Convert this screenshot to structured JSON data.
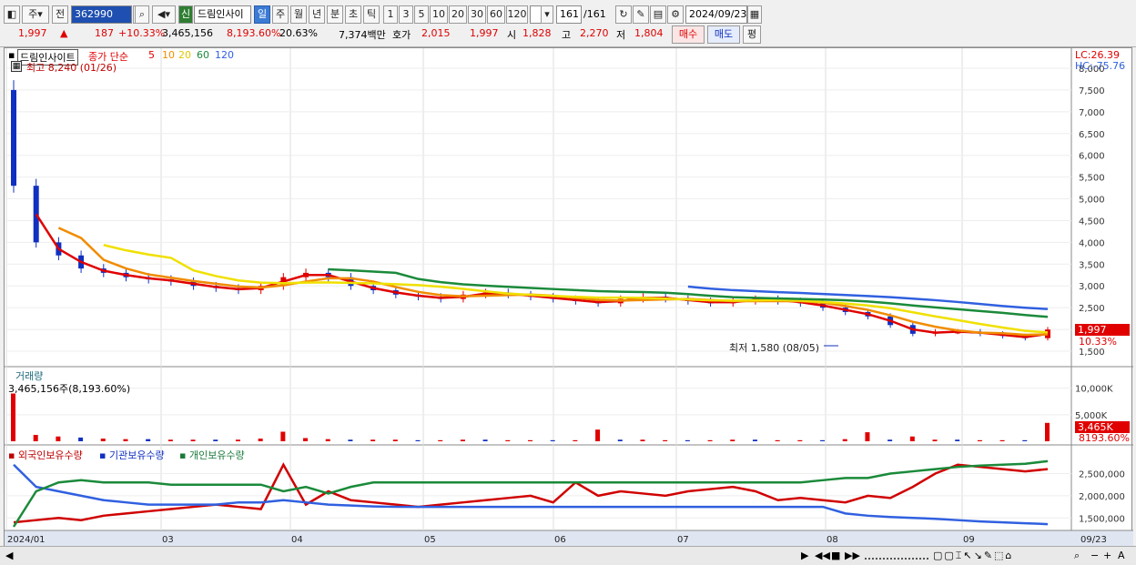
{
  "toolbar": {
    "market_type": "주",
    "period_label": "전",
    "code": "362990",
    "new_badge": "신",
    "stock_name": "드림인사이",
    "periods": [
      "일",
      "주",
      "월",
      "년",
      "분",
      "초",
      "틱"
    ],
    "selected_period": "일",
    "intervals": [
      "1",
      "3",
      "5",
      "10",
      "20",
      "30",
      "60",
      "120"
    ],
    "count": "161",
    "total": "/161",
    "date": "2024/09/23"
  },
  "quote": {
    "price": "1,997",
    "change_arrow": "▲",
    "change": "187",
    "change_pct": "+10.33%",
    "volume": "3,465,156",
    "volume_pct": "8,193.60%",
    "turnover_pct": "20.63%",
    "amount": "7,374백만",
    "bid_label": "호가",
    "bid1": "2,015",
    "bid2": "1,997",
    "open_label": "시",
    "open": "1,828",
    "high_label": "고",
    "high": "2,270",
    "low_label": "저",
    "low": "1,804",
    "buy_label": "매수",
    "sell_label": "매도",
    "eval_label": "평"
  },
  "price_panel": {
    "legend_name": "드림인사이트",
    "legend_ma": "종가 단순",
    "ma_periods": [
      "5",
      "10",
      "20",
      "60",
      "120"
    ],
    "ma_colors": [
      "#e00000",
      "#f08c00",
      "#f0e000",
      "#1a8a3a",
      "#3060e0"
    ],
    "high_note": "최고 8,240 (01/26)",
    "low_note": "최저 1,580 (08/05)",
    "lc": "LC:26.39",
    "hc": "HC:-75.76",
    "y_ticks": [
      "8,000",
      "7,500",
      "7,000",
      "6,500",
      "6,000",
      "5,500",
      "5,000",
      "4,500",
      "4,000",
      "3,500",
      "3,000",
      "2,500",
      "2,000",
      "1,500"
    ],
    "current_price": "1,997",
    "current_pct": "10.33%"
  },
  "volume_panel": {
    "title": "거래량",
    "note": "3,465,156주(8,193.60%)",
    "y_ticks": [
      "10,000K",
      "5,000K"
    ],
    "current": "3,465K",
    "current_pct": "8193.60%"
  },
  "holding_panel": {
    "legend": [
      "외국인보유수량",
      "기관보유수량",
      "개인보유수량"
    ],
    "y_ticks": [
      "2,500,000",
      "2,000,000",
      "1,500,000"
    ]
  },
  "x_axis": [
    "2024/01",
    "03",
    "04",
    "05",
    "06",
    "07",
    "08",
    "09",
    "09/23"
  ],
  "chart_data": {
    "type": "line",
    "ohlc_close_approx": [
      5300,
      4000,
      3700,
      3400,
      3300,
      3200,
      3150,
      3100,
      3000,
      2950,
      2900,
      3000,
      3200,
      3300,
      3200,
      3000,
      2900,
      2800,
      2750,
      2700,
      2800,
      2850,
      2800,
      2750,
      2700,
      2650,
      2600,
      2700,
      2750,
      2700,
      2650,
      2600,
      2650,
      2700,
      2650,
      2600,
      2500,
      2400,
      2300,
      2100,
      1900,
      1950,
      1950,
      1900,
      1850,
      1800,
      1997
    ],
    "price_range": [
      1500,
      8000
    ]
  }
}
